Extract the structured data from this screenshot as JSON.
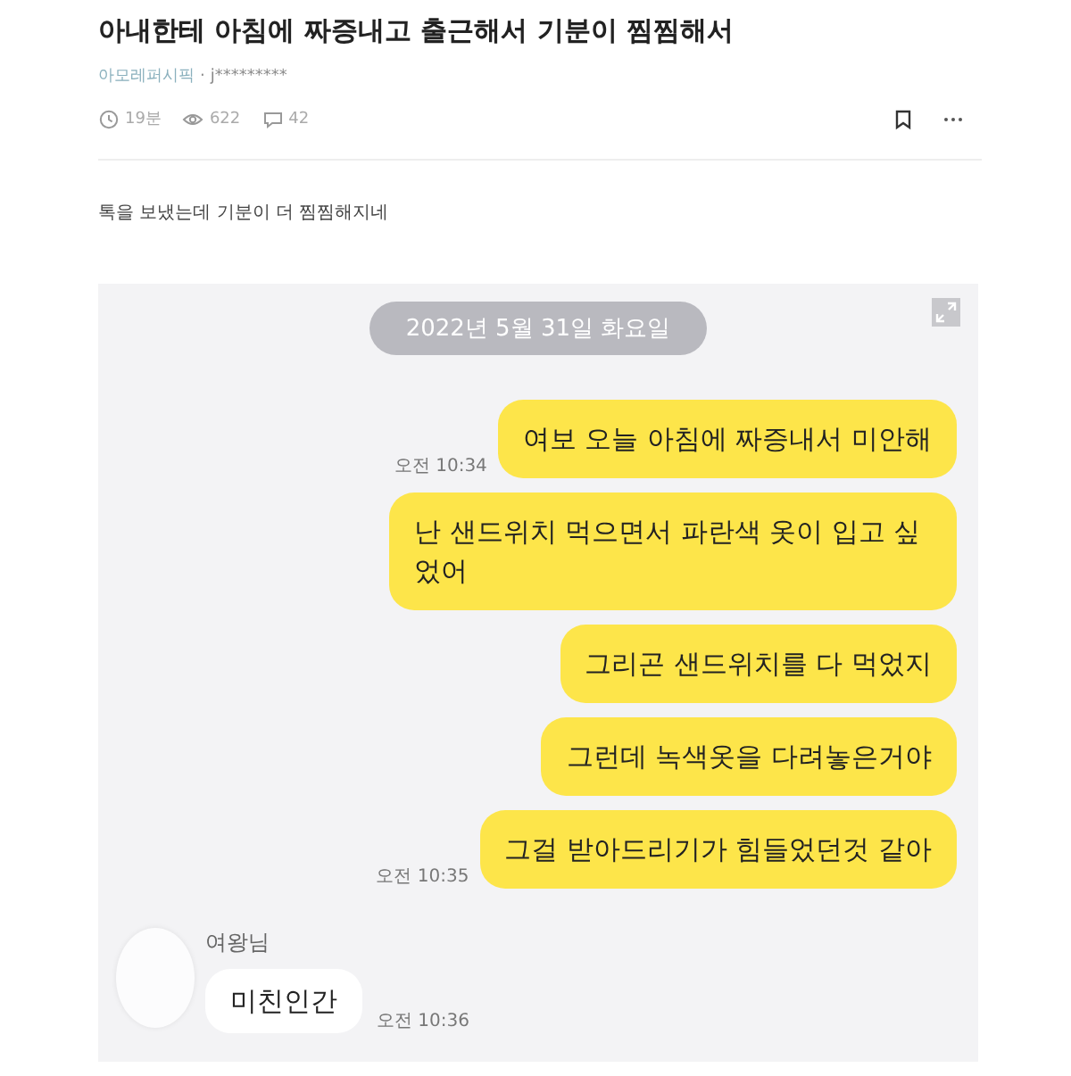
{
  "post": {
    "title": "아내한테 아침에 짜증내고 출근해서 기분이 찜찜해서",
    "board": "아모레퍼시픽",
    "separator": "·",
    "author": "j*********",
    "stats": [
      {
        "kind": "time",
        "text": "19분"
      },
      {
        "kind": "views",
        "text": "622"
      },
      {
        "kind": "comments",
        "text": "42"
      }
    ],
    "body": "톡을 보냈는데 기분이 더 찜찜해지네"
  },
  "chat": {
    "date": "2022년 5월 31일 화요일",
    "messages": [
      {
        "kind": "me",
        "text": "여보 오늘 아침에 짜증내서 미안해",
        "time": "오전 10:34"
      },
      {
        "kind": "me",
        "text": "난 샌드위치 먹으면서 파란색 옷이 입고 싶었어"
      },
      {
        "kind": "me",
        "text": "그리곤 샌드위치를 다 먹었지"
      },
      {
        "kind": "me",
        "text": "그런데 녹색옷을 다려놓은거야"
      },
      {
        "kind": "me",
        "text": "그걸 받아드리기가 힘들었던것 같아",
        "time": "오전 10:35"
      },
      {
        "kind": "other",
        "sender": "여왕님",
        "text": "미친인간",
        "time": "오전 10:36"
      }
    ]
  }
}
